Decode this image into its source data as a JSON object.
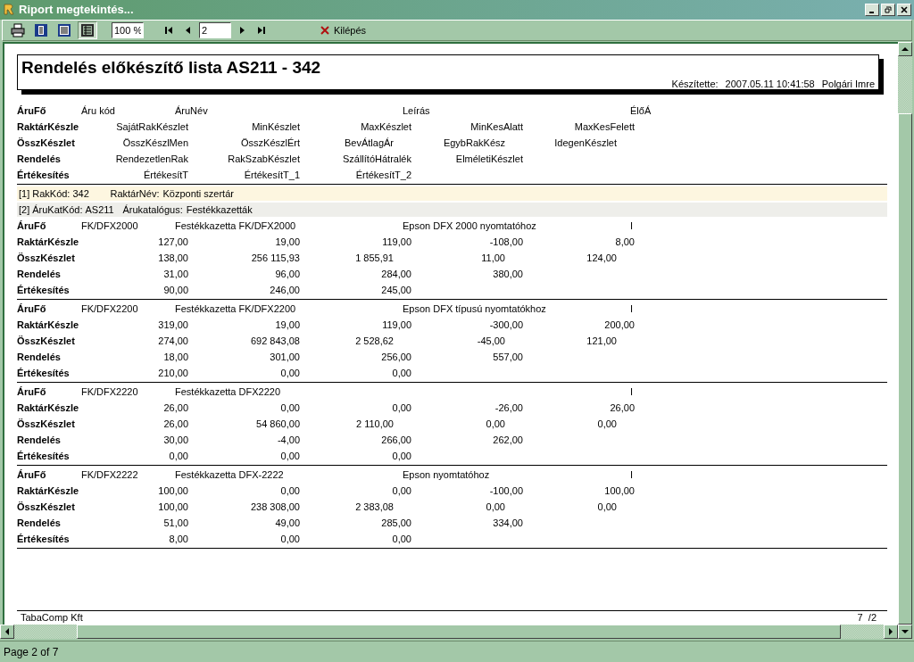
{
  "window": {
    "title": "Riport megtekintés..."
  },
  "toolbar": {
    "view_buttons": [
      {
        "selected": false
      },
      {
        "selected": false
      },
      {
        "selected": true
      }
    ],
    "zoom": "100 %",
    "page": "2",
    "exit_label": "Kilépés"
  },
  "report": {
    "title": "Rendelés előkészítő lista AS211 - 342",
    "made_by_label": "Készítette:",
    "timestamp": "2007.05.11 10:41:58",
    "author": "Polgári Imre",
    "column_headers": {
      "head": {
        "label": "ÁruFő",
        "code": "Áru kód",
        "name": "ÁruNév",
        "description": "Leírás",
        "flag": "ÉlőÁ"
      },
      "rows": [
        {
          "label": "RaktárKészle",
          "values": [
            "SajátRakKészlet",
            "MinKészlet",
            "MaxKészlet",
            "MinKesAlatt",
            "MaxKesFelett"
          ]
        },
        {
          "label": "ÖsszKészlet",
          "values": [
            "ÖsszKészlMen",
            "ÖsszKészlÉrt",
            "BevÁtlagÁr",
            "EgybRakKész",
            "IdegenKészlet"
          ]
        },
        {
          "label": "Rendelés",
          "values": [
            "RendezetlenRak",
            "RakSzabKészlet",
            "SzállítóHátralék",
            "ElméletiKészlet"
          ]
        },
        {
          "label": "Értékesítés",
          "values": [
            "ÉrtékesítT",
            "ÉrtékesítT_1",
            "ÉrtékesítT_2"
          ]
        }
      ]
    },
    "groups": [
      {
        "level": "[1]",
        "key_label": "RakKód:",
        "key": "342",
        "name_label": "RaktárNév:",
        "name": "Központi szertár",
        "color": "#fdf6e0"
      },
      {
        "level": "[2]",
        "key_label": "ÁruKatKód:",
        "key": "AS211",
        "name_label": "Árukatalógus:",
        "name": "Festékkazetták",
        "color": "#eeeeea"
      }
    ],
    "items": [
      {
        "label": "ÁruFő",
        "code": "FK/DFX2000",
        "name": "Festékkazetta FK/DFX2000",
        "description": "Epson DFX 2000 nyomtatóhoz",
        "flag": "I",
        "rows": [
          {
            "label": "RaktárKészle",
            "values": [
              "127,00",
              "19,00",
              "119,00",
              "-108,00",
              "8,00"
            ]
          },
          {
            "label": "ÖsszKészlet",
            "values": [
              "138,00",
              "256 115,93",
              "1 855,91",
              "11,00",
              "124,00"
            ]
          },
          {
            "label": "Rendelés",
            "values": [
              "31,00",
              "96,00",
              "284,00",
              "380,00"
            ]
          },
          {
            "label": "Értékesítés",
            "values": [
              "90,00",
              "246,00",
              "245,00"
            ]
          }
        ]
      },
      {
        "label": "ÁruFő",
        "code": "FK/DFX2200",
        "name": "Festékkazetta FK/DFX2200",
        "description": "Epson DFX típusú nyomtatókhoz",
        "flag": "I",
        "rows": [
          {
            "label": "RaktárKészle",
            "values": [
              "319,00",
              "19,00",
              "119,00",
              "-300,00",
              "200,00"
            ]
          },
          {
            "label": "ÖsszKészlet",
            "values": [
              "274,00",
              "692 843,08",
              "2 528,62",
              "-45,00",
              "121,00"
            ]
          },
          {
            "label": "Rendelés",
            "values": [
              "18,00",
              "301,00",
              "256,00",
              "557,00"
            ]
          },
          {
            "label": "Értékesítés",
            "values": [
              "210,00",
              "0,00",
              "0,00"
            ]
          }
        ]
      },
      {
        "label": "ÁruFő",
        "code": "FK/DFX2220",
        "name": "Festékkazetta DFX2220",
        "flag": "I",
        "rows": [
          {
            "label": "RaktárKészle",
            "values": [
              "26,00",
              "0,00",
              "0,00",
              "-26,00",
              "26,00"
            ]
          },
          {
            "label": "ÖsszKészlet",
            "values": [
              "26,00",
              "54 860,00",
              "2 110,00",
              "0,00",
              "0,00"
            ]
          },
          {
            "label": "Rendelés",
            "values": [
              "30,00",
              "-4,00",
              "266,00",
              "262,00"
            ]
          },
          {
            "label": "Értékesítés",
            "values": [
              "0,00",
              "0,00",
              "0,00"
            ]
          }
        ]
      },
      {
        "label": "ÁruFő",
        "code": "FK/DFX2222",
        "name": "Festékkazetta DFX-2222",
        "description": "Epson nyomtatóhoz",
        "flag": "I",
        "rows": [
          {
            "label": "RaktárKészle",
            "values": [
              "100,00",
              "0,00",
              "0,00",
              "-100,00",
              "100,00"
            ]
          },
          {
            "label": "ÖsszKészlet",
            "values": [
              "100,00",
              "238 308,00",
              "2 383,08",
              "0,00",
              "0,00"
            ]
          },
          {
            "label": "Rendelés",
            "values": [
              "51,00",
              "49,00",
              "285,00",
              "334,00"
            ]
          },
          {
            "label": "Értékesítés",
            "values": [
              "8,00",
              "0,00",
              "0,00"
            ]
          }
        ]
      }
    ],
    "footer": {
      "company": "TabaComp Kft",
      "page": "7  /2"
    }
  },
  "status_bar": "Page 2 of 7"
}
